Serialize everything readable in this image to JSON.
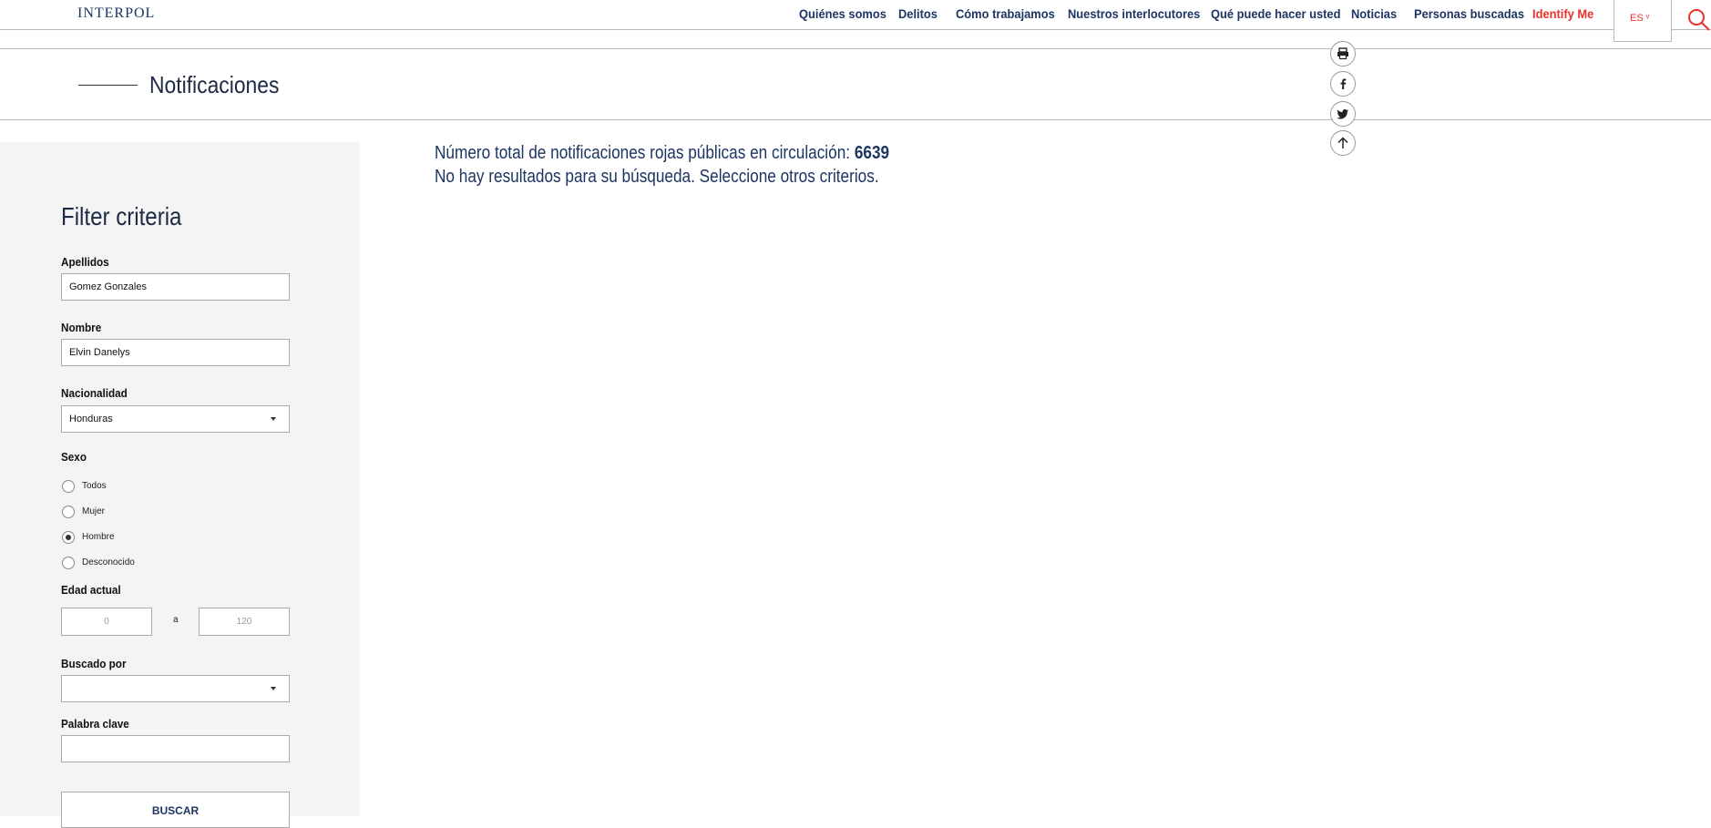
{
  "header": {
    "logo": "INTERPOL",
    "nav": [
      "Quiénes somos",
      "Delitos",
      "Cómo trabajamos",
      "Nuestros interlocutores",
      "Qué puede hacer usted",
      "Noticias",
      "Personas buscadas",
      "Identify Me"
    ],
    "language": "ES ᵛ",
    "search_icon": "search-icon",
    "accent_color": "#e8322b"
  },
  "page": {
    "title": "Notificaciones"
  },
  "share": {
    "icons": [
      "print-icon",
      "facebook-icon",
      "twitter-icon",
      "arrow-up-icon"
    ]
  },
  "results": {
    "total_label": "Número total de notificaciones rojas públicas en circulación: ",
    "total_count": "6639",
    "no_results": "No hay resultados para su búsqueda. Seleccione otros criterios."
  },
  "filter": {
    "title": "Filter criteria",
    "apellidos_label": "Apellidos",
    "apellidos_value": "Gomez Gonzales",
    "nombre_label": "Nombre",
    "nombre_value": "Elvin Danelys",
    "nacionalidad_label": "Nacionalidad",
    "nacionalidad_value": "Honduras",
    "sexo_label": "Sexo",
    "sexo_options": [
      "Todos",
      "Mujer",
      "Hombre",
      "Desconocido"
    ],
    "sexo_selected": "Hombre",
    "edad_label": "Edad actual",
    "edad_min_placeholder": "0",
    "edad_sep": "a",
    "edad_max_placeholder": "120",
    "buscado_label": "Buscado por",
    "buscado_value": "",
    "palabra_label": "Palabra clave",
    "palabra_value": "",
    "submit_label": "BUSCAR"
  }
}
